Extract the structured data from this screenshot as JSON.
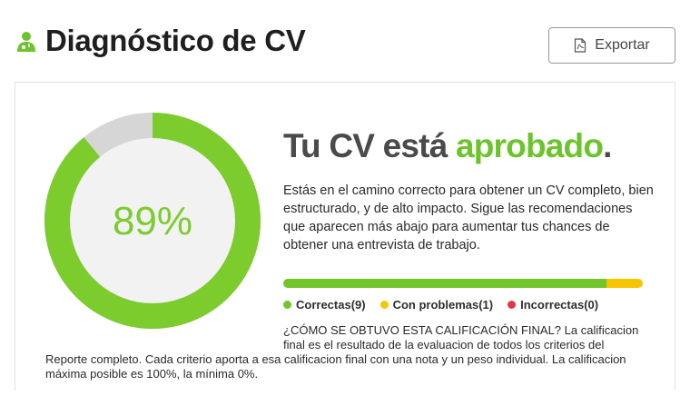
{
  "header": {
    "title": "Diagnóstico de CV",
    "icon": "user-doctor-icon",
    "export_label": "Exportar",
    "export_icon": "pdf-file-icon"
  },
  "score": {
    "value_text": "89%",
    "fraction": 0.89,
    "color_ok": "#7ccc2e",
    "color_rest": "#d6d6d6"
  },
  "result": {
    "title_prefix": "Tu CV está",
    "title_accent": "aprobado",
    "title_suffix": ".",
    "description": "Estás en el camino correcto para obtener un CV completo, bien estructurado, y de alto impacto. Sigue las recomendaciones que aparecen más abajo para aumentar tus chances de obtener una entrevista de trabajo."
  },
  "breakdown": {
    "segments": [
      {
        "label": "Correctas(9)",
        "count": 9,
        "color": "#72c52a"
      },
      {
        "label": "Con problemas(1)",
        "count": 1,
        "color": "#f7c500"
      },
      {
        "label": "Incorrectas(0)",
        "count": 0,
        "color": "#e2364c"
      }
    ]
  },
  "explanation": {
    "line_part1": "¿CÓMO SE OBTUVO ESTA CALIFICACIÓN FINAL? La calificacion final es el resultado de la evaluacion de todos los criterios del",
    "line_part2": "Reporte completo. Cada criterio aporta a esa calificacion final con una nota y un peso individual. La calificacion máxima posible es 100%, la mínima 0%."
  }
}
